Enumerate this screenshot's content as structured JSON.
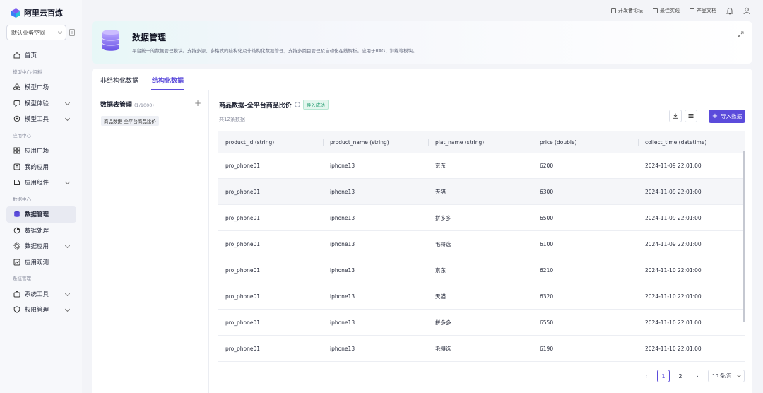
{
  "app": {
    "name": "阿里云百炼"
  },
  "workspace": {
    "label": "默认业务空间"
  },
  "sidebar": {
    "home": "首页",
    "section_model": "模型中心-资料",
    "model_square": "模型广场",
    "model_experience": "模型体验",
    "model_tools": "模型工具",
    "section_app": "应用中心",
    "app_square": "应用广场",
    "my_apps": "我的应用",
    "app_components": "应用组件",
    "section_data": "数据中心",
    "data_management": "数据管理",
    "data_processing": "数据处理",
    "data_application": "数据应用",
    "app_observation": "应用观测",
    "section_system": "系统管理",
    "system_tools": "系统工具",
    "permission_management": "权限管理"
  },
  "topbar": {
    "developer_forum": "开发者论坛",
    "best_practice": "最佳实践",
    "product_docs": "产品文档"
  },
  "header": {
    "title": "数据管理",
    "description": "平台统一的数据管理模块。支持多源、多格式的结构化及非结构化数据管理，支持多类目管理及自动化在线解析。应用于RAG、训练等模块。"
  },
  "tabs": [
    {
      "label": "非结构化数据",
      "active": false
    },
    {
      "label": "结构化数据",
      "active": true
    }
  ],
  "left_panel": {
    "title": "数据表管理",
    "count": "(1/1000)",
    "items": [
      "商品数据-全平台商品比价"
    ]
  },
  "table_view": {
    "title": "商品数据-全平台商品比价",
    "status_badge": "导入成功",
    "subtitle": "共12条数据",
    "import_button": "导入数据",
    "columns": [
      "product_id (string)",
      "product_name (string)",
      "plat_name (string)",
      "price (double)",
      "collect_time (datetime)"
    ],
    "rows": [
      [
        "pro_phone01",
        "iphone13",
        "京东",
        "6200",
        "2024-11-09 22:01:00"
      ],
      [
        "pro_phone01",
        "iphone13",
        "天猫",
        "6300",
        "2024-11-09 22:01:00"
      ],
      [
        "pro_phone01",
        "iphone13",
        "拼多多",
        "6500",
        "2024-11-09 22:01:00"
      ],
      [
        "pro_phone01",
        "iphone13",
        "毛得选",
        "6100",
        "2024-11-09 22:01:00"
      ],
      [
        "pro_phone01",
        "iphone13",
        "京东",
        "6210",
        "2024-11-10 22:01:00"
      ],
      [
        "pro_phone01",
        "iphone13",
        "天猫",
        "6320",
        "2024-11-10 22:01:00"
      ],
      [
        "pro_phone01",
        "iphone13",
        "拼多多",
        "6550",
        "2024-11-10 22:01:00"
      ],
      [
        "pro_phone01",
        "iphone13",
        "毛得选",
        "6190",
        "2024-11-10 22:01:00"
      ]
    ]
  },
  "pagination": {
    "pages": [
      "1",
      "2"
    ],
    "current": "1",
    "page_size": "10 条/页"
  },
  "colors": {
    "accent": "#5b4bdb",
    "success": "#1c9a6c"
  }
}
